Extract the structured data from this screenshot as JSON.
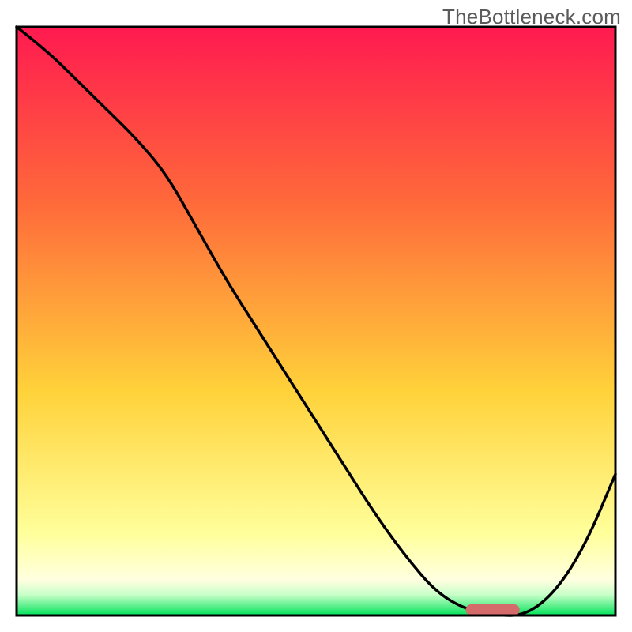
{
  "watermark": "TheBottleneck.com",
  "colors": {
    "gradient_top": "#ff1a50",
    "gradient_mid1": "#ff6a3a",
    "gradient_mid2": "#ffd23a",
    "gradient_pale": "#ffff9a",
    "gradient_green": "#00e25a",
    "stroke": "#000000",
    "marker": "#d46a6a",
    "frame": "#000000"
  },
  "chart_data": {
    "type": "line",
    "title": "",
    "xlabel": "",
    "ylabel": "",
    "xlim": [
      0,
      100
    ],
    "ylim": [
      0,
      100
    ],
    "grid": false,
    "legend": false,
    "x": [
      0,
      5,
      10,
      15,
      20,
      25,
      30,
      35,
      40,
      45,
      50,
      55,
      60,
      65,
      70,
      75,
      80,
      85,
      90,
      95,
      100
    ],
    "values": [
      100,
      96,
      91,
      86,
      81,
      75,
      66,
      57,
      49,
      41,
      33,
      25,
      17,
      10,
      4,
      1,
      0,
      0,
      4,
      12,
      24
    ],
    "marker_segment": {
      "x_start": 75,
      "x_end": 84,
      "y": 0
    }
  }
}
